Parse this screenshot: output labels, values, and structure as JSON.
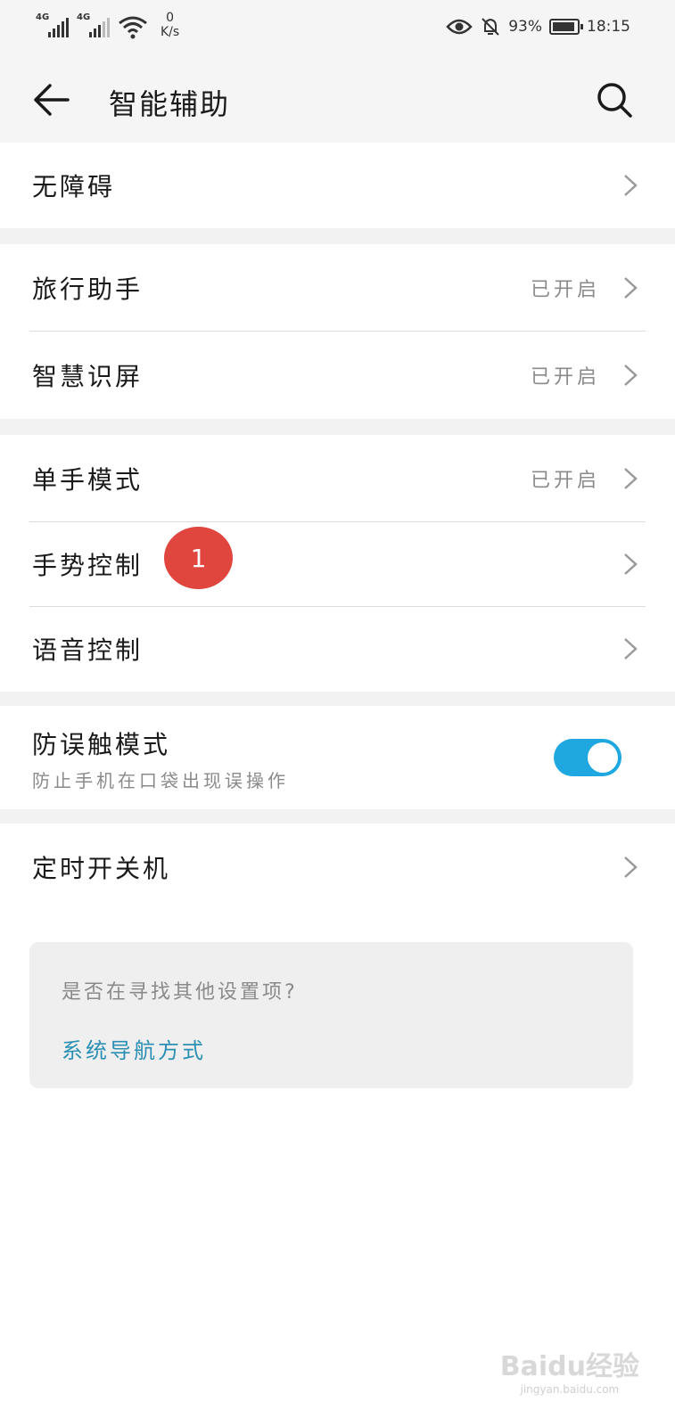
{
  "status_bar": {
    "signal1_tag": "4G",
    "signal2_tag": "4G",
    "speed_value": "0",
    "speed_unit": "K/s",
    "battery_text": "93%",
    "time": "18:15",
    "icons": [
      "signal-icon",
      "wifi-icon",
      "eye-icon",
      "bell-off-icon",
      "battery-icon"
    ]
  },
  "header": {
    "title": "智能辅助"
  },
  "sections": {
    "accessibility": {
      "label": "无障碍"
    },
    "travel": {
      "label": "旅行助手",
      "value": "已开启"
    },
    "smart_screen": {
      "label": "智慧识屏",
      "value": "已开启"
    },
    "one_hand": {
      "label": "单手模式",
      "value": "已开启"
    },
    "gesture": {
      "label": "手势控制"
    },
    "voice": {
      "label": "语音控制"
    },
    "pocket_mode": {
      "label": "防误触模式",
      "desc": "防止手机在口袋出现误操作",
      "enabled": true
    },
    "schedule_power": {
      "label": "定时开关机"
    }
  },
  "badge": {
    "number": "1",
    "color": "#e0453e"
  },
  "tip_card": {
    "question": "是否在寻找其他设置项?",
    "link": "系统导航方式"
  },
  "watermark": {
    "brand": "Baidu经验",
    "url": "jingyan.baidu.com"
  },
  "colors": {
    "accent": "#1fa8e0",
    "link": "#2a8fb3",
    "badge": "#e0453e"
  }
}
